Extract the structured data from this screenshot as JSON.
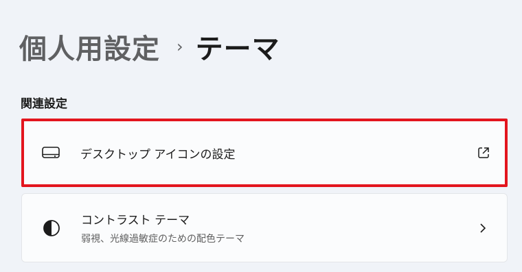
{
  "breadcrumb": {
    "parent": "個人用設定",
    "separator": "›",
    "current": "テーマ"
  },
  "related_settings": {
    "title": "関連設定",
    "items": [
      {
        "title": "デスクトップ アイコンの設定",
        "icon": "desktop-monitor-icon",
        "trailing_icon": "open-external-icon",
        "highlighted": true,
        "highlight_color": "#e3151e"
      },
      {
        "title": "コントラスト テーマ",
        "subtitle": "弱視、光線過敏症のための配色テーマ",
        "icon": "contrast-icon",
        "trailing_icon": "chevron-right-icon"
      }
    ]
  }
}
